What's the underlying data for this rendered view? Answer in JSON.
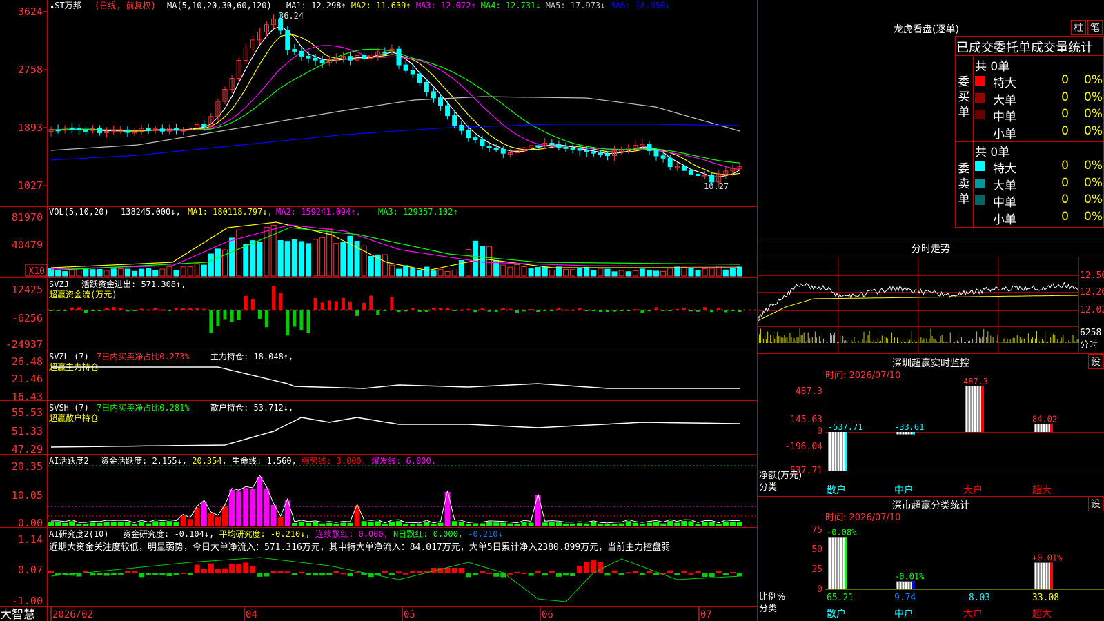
{
  "stock": {
    "name": "★ST万邦",
    "period": "(日线, 前复权)",
    "cross_marks": "+"
  },
  "ma_legend": {
    "label": "MA(5,10,20,30,60,120)",
    "items": [
      {
        "text": "MA1: 12.298↑",
        "color": "#ffffff"
      },
      {
        "text": "MA2: 11.639↑",
        "color": "#ffff00"
      },
      {
        "text": "MA3: 12.072↑",
        "color": "#ff00ff"
      },
      {
        "text": "MA4: 12.731↓",
        "color": "#00ff00"
      },
      {
        "text": "MA5: 17.973↓",
        "color": "#c0c0c0"
      },
      {
        "text": "MA6: 18.950↓",
        "color": "#0000ff"
      }
    ]
  },
  "price_axis": [
    "3624",
    "2758",
    "1893",
    "1027"
  ],
  "price_annotations": {
    "high": "36.24",
    "low": "10.27"
  },
  "vol": {
    "label": "VOL(5,10,20)",
    "value": "138245.000↓,",
    "ma1": "MA1: 180118.797↓,",
    "ma2": "MA2: 159241.094↑,",
    "ma3": "MA3: 129357.102↑",
    "axis": [
      "81970",
      "40479",
      "X10"
    ]
  },
  "svzj": {
    "label": "SVZJ",
    "line": "活跃资金进出: 571.308↑,",
    "sub": "超赢资金流(万元)",
    "axis": [
      "12425",
      "-6256",
      "-24937"
    ]
  },
  "svzl": {
    "label": "SVZL (7)",
    "stat": "7日内买卖净占比0.273%",
    "line": "主力持仓: 18.048↑,",
    "sub": "超赢主力持仓",
    "axis": [
      "26.48",
      "21.46",
      "16.43"
    ]
  },
  "svsh": {
    "label": "SVSH (7)",
    "stat": "7日内买卖净占比0.281%",
    "line": "散户持仓: 53.712↓,",
    "sub": "超赢散户持仓",
    "axis": [
      "55.53",
      "51.33",
      "47.29"
    ]
  },
  "ai_active": {
    "label": "AI活跃度2",
    "items": [
      {
        "text": "资金活跃度: 2.155↓,",
        "color": "#ffffff"
      },
      {
        "text": "20.354,",
        "color": "#ffff00"
      },
      {
        "text": "生命线: 1.560,",
        "color": "#ffffff"
      },
      {
        "text": "强势线: 3.000,",
        "color": "#ff0000"
      },
      {
        "text": "爆发线: 6.000,",
        "color": "#ff00ff"
      }
    ],
    "axis": [
      "20.35",
      "10.05",
      "0.00"
    ]
  },
  "ai_research": {
    "label": "AI研究度2(10)",
    "items": [
      {
        "text": "资金研究度: -0.104↓,",
        "color": "#ffffff"
      },
      {
        "text": "平均研究度: -0.210↓,",
        "color": "#ffff00"
      },
      {
        "text": "连续飘红: 0.000,",
        "color": "#ff00ff"
      },
      {
        "text": "N日飘红: 0.000,",
        "color": "#00ff00"
      },
      {
        "text": "-0.210↓",
        "color": "#0080ff"
      }
    ],
    "note": "近期大资金关注度较低，明显弱势，今日大单净流入：571.316万元，其中特大单净流入：84.017万元，大单5日累计净入2380.899万元，当前主力控盘弱",
    "axis": [
      "1.14",
      "0.07",
      "-1.00"
    ]
  },
  "date_axis": {
    "brand": "大智慧",
    "ticks": [
      "2026/02",
      "04",
      "05",
      "06",
      "07"
    ]
  },
  "dragon": {
    "title": "龙虎看盘(逐单)",
    "btn_bar": "柱",
    "btn_pen": "笔",
    "header": "已成交委托单成交量统计",
    "buy": {
      "side_label": "委买单",
      "total": "共 0单",
      "rows": [
        {
          "name": "特大",
          "color": "#ff0000",
          "count": "0",
          "pct": "0%"
        },
        {
          "name": "大单",
          "color": "#990000",
          "count": "0",
          "pct": "0%"
        },
        {
          "name": "中单",
          "color": "#660000",
          "count": "0",
          "pct": "0%"
        },
        {
          "name": "小单",
          "color": "#000000",
          "count": "0",
          "pct": "0%"
        }
      ]
    },
    "sell": {
      "side_label": "委卖单",
      "total": "共 0单",
      "rows": [
        {
          "name": "特大",
          "color": "#00ffff",
          "count": "0",
          "pct": "0%"
        },
        {
          "name": "大单",
          "color": "#009999",
          "count": "0",
          "pct": "0%"
        },
        {
          "name": "中单",
          "color": "#006666",
          "count": "0",
          "pct": "0%"
        },
        {
          "name": "小单",
          "color": "#000000",
          "count": "0",
          "pct": "0%"
        }
      ]
    }
  },
  "intraday": {
    "title": "分时走势",
    "axis": [
      "12.50",
      "12.26",
      "12.02"
    ],
    "vol_label": "6258",
    "vol_sub": "分时"
  },
  "sz_monitor": {
    "title": "深圳超赢实时监控",
    "btn": "设",
    "time": "时间: 2026/07/10",
    "axis": [
      "487.3",
      "145.63",
      "0",
      "-196.04",
      "-537.71"
    ],
    "unit_label": "净额(万元)",
    "cat_label": "分类",
    "chart_data": {
      "type": "bar",
      "categories": [
        "散户",
        "中户",
        "大户",
        "超大"
      ],
      "values": [
        -537.71,
        -33.61,
        487.3,
        84.02
      ],
      "labels": [
        "-537.71",
        "-33.61",
        "487.3",
        "84.02"
      ]
    }
  },
  "sz_class": {
    "title": "深市超赢分类统计",
    "btn": "设",
    "time": "时间: 2026/07/10",
    "axis": [
      "75",
      "50",
      "25",
      "0"
    ],
    "ratio_label": "比例%",
    "cat_label": "分类",
    "chart_data": {
      "type": "bar",
      "categories": [
        "散户",
        "中户",
        "大户",
        "超大"
      ],
      "values": [
        65.21,
        9.74,
        -8.03,
        33.08
      ],
      "changes": [
        "-0.08%",
        "-0.01%",
        "",
        "+0.01%"
      ]
    }
  }
}
